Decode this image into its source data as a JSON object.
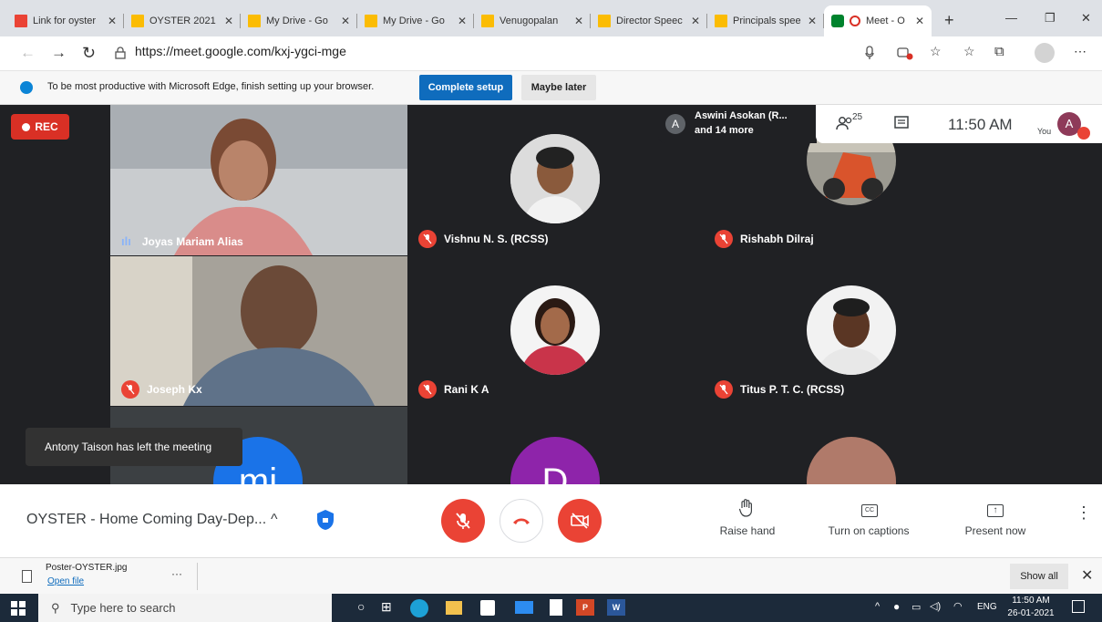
{
  "browser": {
    "tabs": [
      {
        "title": "Link for oyster",
        "icon": "gmail-icon",
        "active": false
      },
      {
        "title": "OYSTER 2021 I",
        "icon": "drive-icon",
        "active": false
      },
      {
        "title": "My Drive - Go",
        "icon": "drive-icon",
        "active": false
      },
      {
        "title": "My Drive - Go",
        "icon": "drive-icon",
        "active": false
      },
      {
        "title": "Venugopalan",
        "icon": "drive-icon",
        "active": false
      },
      {
        "title": "Director Speec",
        "icon": "drive-icon",
        "active": false
      },
      {
        "title": "Principals spee",
        "icon": "drive-icon",
        "active": false
      },
      {
        "title": "Meet - O",
        "icon": "meet-icon",
        "active": true
      }
    ],
    "url": "https://meet.google.com/kxj-ygci-mge",
    "infobar": {
      "text": "To be most productive with Microsoft Edge, finish setting up your browser.",
      "primary_button": "Complete setup",
      "secondary_button": "Maybe later"
    }
  },
  "meet": {
    "rec_label": "REC",
    "presenter_text_line1": "Aswini Asokan (R...",
    "presenter_text_line2": "and 14 more",
    "presenter_initial": "A",
    "participants_count": "25",
    "time": "11:50 AM",
    "self_label": "You",
    "self_initial": "A",
    "tiles": [
      {
        "name": "Joyas Mariam Alias",
        "speaking": true
      },
      {
        "name": "Vishnu N. S. (RCSS)",
        "speaking": false
      },
      {
        "name": "Rishabh Dilraj",
        "speaking": false
      },
      {
        "name": "Joseph Kx",
        "speaking": false
      },
      {
        "name": "Rani K A",
        "speaking": false
      },
      {
        "name": "Titus P. T. C. (RCSS)",
        "speaking": false
      }
    ],
    "partial_initials": [
      "mi",
      "D"
    ],
    "toast": "Antony Taison has left the meeting",
    "meeting_title": "OYSTER - Home Coming Day-Dep...",
    "raise_hand": "Raise hand",
    "captions": "Turn on captions",
    "present": "Present now"
  },
  "downloads": {
    "file_name": "Poster-OYSTER.jpg",
    "open_file": "Open file",
    "show_all": "Show all"
  },
  "taskbar": {
    "search_placeholder": "Type here to search",
    "lang": "ENG",
    "time": "11:50 AM",
    "date": "26-01-2021"
  }
}
